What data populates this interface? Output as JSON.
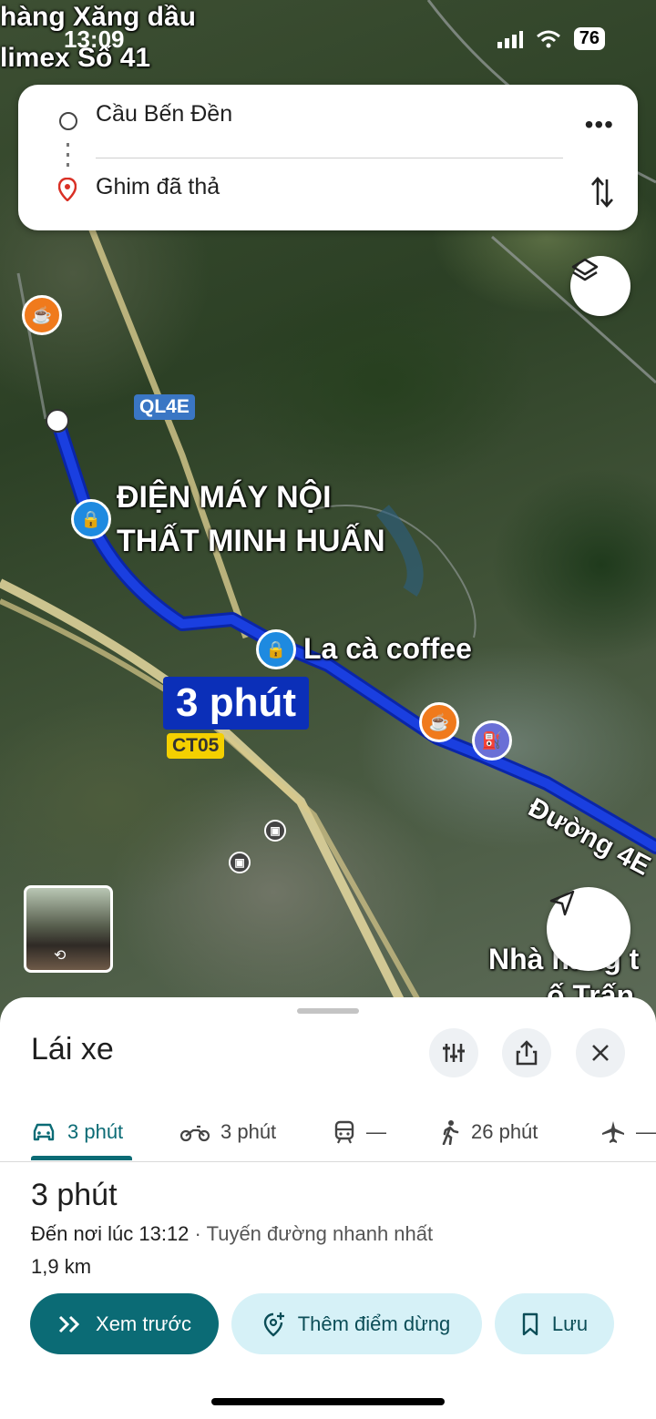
{
  "status_bar": {
    "time": "13:09",
    "battery": "76"
  },
  "map": {
    "labels": {
      "top_left_1": "hàng Xăng dầu",
      "top_left_2": "limex Số 41",
      "poi_dien_may_1": "ĐIỆN MÁY NỘI",
      "poi_dien_may_2": "THẤT MINH HUẤN",
      "poi_lacafe": "La cà coffee",
      "road_4e": "Đường 4E",
      "bottom_right_1": "Nhà hàng t",
      "bottom_right_2": "ố Trấn"
    },
    "shields": {
      "ql4e": "QL4E",
      "ct05": "CT05"
    },
    "eta_label": "3 phút",
    "route_color": "#1a3fe0"
  },
  "route_card": {
    "origin": "Cầu Bến Đền",
    "destination": "Ghim đã thả"
  },
  "sheet": {
    "title": "Lái xe",
    "modes": [
      {
        "icon": "car-icon",
        "label": "3 phút"
      },
      {
        "icon": "motorbike-icon",
        "label": "3 phút"
      },
      {
        "icon": "transit-icon",
        "label": "—"
      },
      {
        "icon": "walk-icon",
        "label": "26 phút"
      },
      {
        "icon": "flight-icon",
        "label": "—"
      }
    ],
    "duration": "3 phút",
    "arrival": "Đến nơi lúc 13:12",
    "arrival_sub": "· Tuyến đường nhanh nhất",
    "distance": "1,9 km",
    "buttons": {
      "preview": "Xem trước",
      "add_stop": "Thêm điểm dừng",
      "save": "Lưu"
    }
  }
}
